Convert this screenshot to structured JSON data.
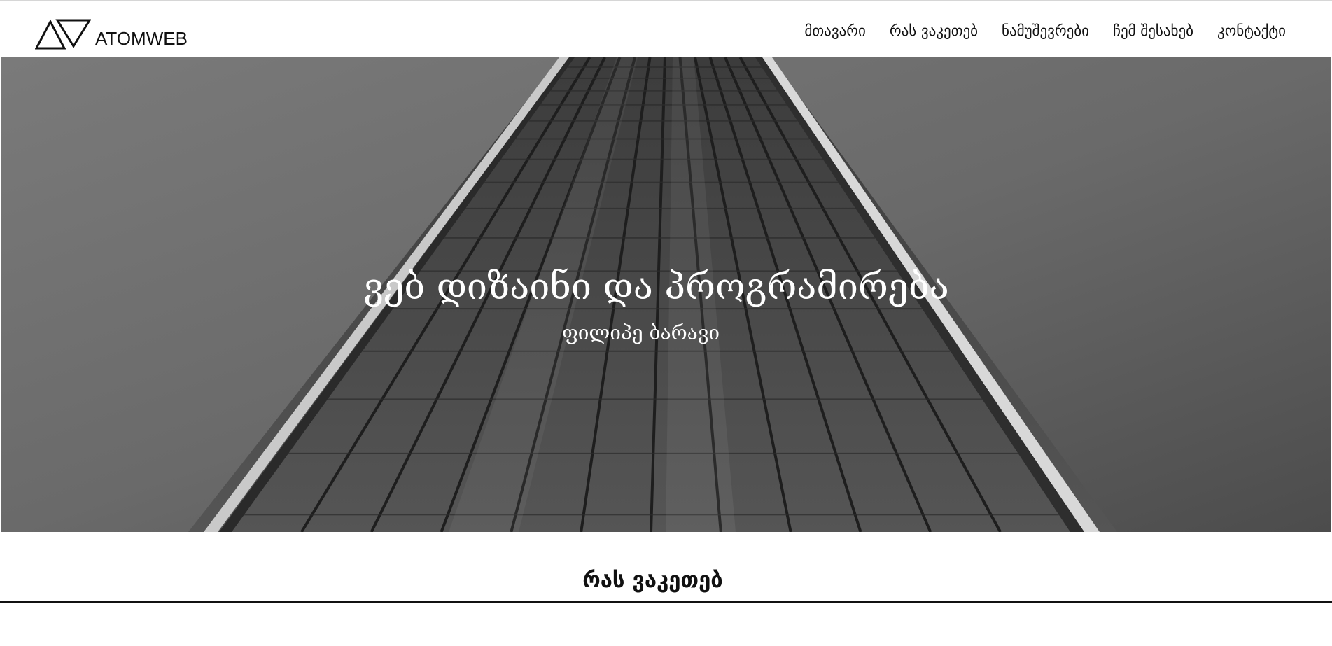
{
  "brand": {
    "name": "ATOMWEB",
    "logo_icon": "triangles-logo-icon"
  },
  "nav": {
    "items": [
      {
        "label": "მთავარი"
      },
      {
        "label": "რას ვაკეთებ"
      },
      {
        "label": "ნამუშევრები"
      },
      {
        "label": "ჩემ შესახებ"
      },
      {
        "label": "კონტაქტი"
      }
    ]
  },
  "hero": {
    "title": "ვებ დიზაინი და პროგრამირება",
    "subtitle": "ფილიპე ბარავი",
    "image": "grayscale skyscraper viewed from below"
  },
  "section": {
    "title": "რას ვაკეთებ"
  },
  "colors": {
    "text": "#111111",
    "hero_text": "#ffffff",
    "hero_bg": "#5a5a5a"
  }
}
